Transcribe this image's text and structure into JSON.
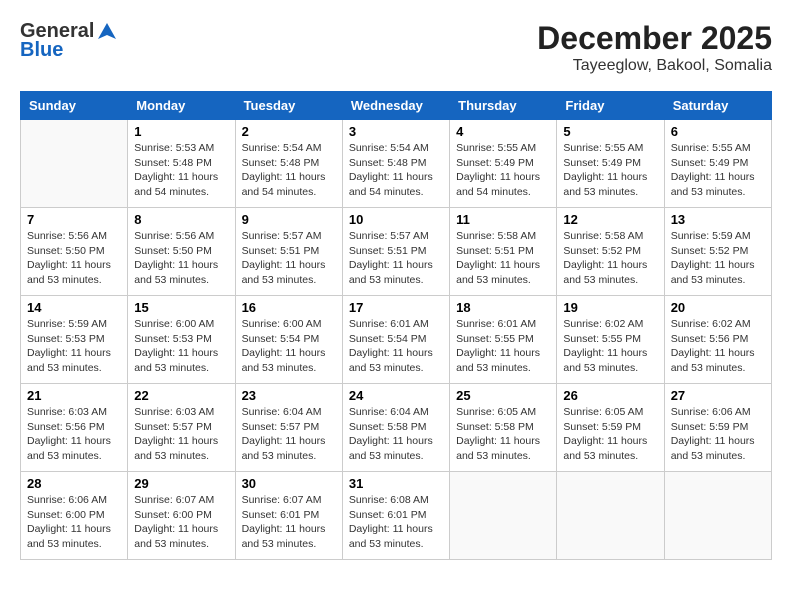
{
  "header": {
    "logo_general": "General",
    "logo_blue": "Blue",
    "month_title": "December 2025",
    "location": "Tayeeglow, Bakool, Somalia"
  },
  "columns": [
    "Sunday",
    "Monday",
    "Tuesday",
    "Wednesday",
    "Thursday",
    "Friday",
    "Saturday"
  ],
  "weeks": [
    [
      {
        "day": "",
        "info": ""
      },
      {
        "day": "1",
        "info": "Sunrise: 5:53 AM\nSunset: 5:48 PM\nDaylight: 11 hours\nand 54 minutes."
      },
      {
        "day": "2",
        "info": "Sunrise: 5:54 AM\nSunset: 5:48 PM\nDaylight: 11 hours\nand 54 minutes."
      },
      {
        "day": "3",
        "info": "Sunrise: 5:54 AM\nSunset: 5:48 PM\nDaylight: 11 hours\nand 54 minutes."
      },
      {
        "day": "4",
        "info": "Sunrise: 5:55 AM\nSunset: 5:49 PM\nDaylight: 11 hours\nand 54 minutes."
      },
      {
        "day": "5",
        "info": "Sunrise: 5:55 AM\nSunset: 5:49 PM\nDaylight: 11 hours\nand 53 minutes."
      },
      {
        "day": "6",
        "info": "Sunrise: 5:55 AM\nSunset: 5:49 PM\nDaylight: 11 hours\nand 53 minutes."
      }
    ],
    [
      {
        "day": "7",
        "info": "Sunrise: 5:56 AM\nSunset: 5:50 PM\nDaylight: 11 hours\nand 53 minutes."
      },
      {
        "day": "8",
        "info": "Sunrise: 5:56 AM\nSunset: 5:50 PM\nDaylight: 11 hours\nand 53 minutes."
      },
      {
        "day": "9",
        "info": "Sunrise: 5:57 AM\nSunset: 5:51 PM\nDaylight: 11 hours\nand 53 minutes."
      },
      {
        "day": "10",
        "info": "Sunrise: 5:57 AM\nSunset: 5:51 PM\nDaylight: 11 hours\nand 53 minutes."
      },
      {
        "day": "11",
        "info": "Sunrise: 5:58 AM\nSunset: 5:51 PM\nDaylight: 11 hours\nand 53 minutes."
      },
      {
        "day": "12",
        "info": "Sunrise: 5:58 AM\nSunset: 5:52 PM\nDaylight: 11 hours\nand 53 minutes."
      },
      {
        "day": "13",
        "info": "Sunrise: 5:59 AM\nSunset: 5:52 PM\nDaylight: 11 hours\nand 53 minutes."
      }
    ],
    [
      {
        "day": "14",
        "info": "Sunrise: 5:59 AM\nSunset: 5:53 PM\nDaylight: 11 hours\nand 53 minutes."
      },
      {
        "day": "15",
        "info": "Sunrise: 6:00 AM\nSunset: 5:53 PM\nDaylight: 11 hours\nand 53 minutes."
      },
      {
        "day": "16",
        "info": "Sunrise: 6:00 AM\nSunset: 5:54 PM\nDaylight: 11 hours\nand 53 minutes."
      },
      {
        "day": "17",
        "info": "Sunrise: 6:01 AM\nSunset: 5:54 PM\nDaylight: 11 hours\nand 53 minutes."
      },
      {
        "day": "18",
        "info": "Sunrise: 6:01 AM\nSunset: 5:55 PM\nDaylight: 11 hours\nand 53 minutes."
      },
      {
        "day": "19",
        "info": "Sunrise: 6:02 AM\nSunset: 5:55 PM\nDaylight: 11 hours\nand 53 minutes."
      },
      {
        "day": "20",
        "info": "Sunrise: 6:02 AM\nSunset: 5:56 PM\nDaylight: 11 hours\nand 53 minutes."
      }
    ],
    [
      {
        "day": "21",
        "info": "Sunrise: 6:03 AM\nSunset: 5:56 PM\nDaylight: 11 hours\nand 53 minutes."
      },
      {
        "day": "22",
        "info": "Sunrise: 6:03 AM\nSunset: 5:57 PM\nDaylight: 11 hours\nand 53 minutes."
      },
      {
        "day": "23",
        "info": "Sunrise: 6:04 AM\nSunset: 5:57 PM\nDaylight: 11 hours\nand 53 minutes."
      },
      {
        "day": "24",
        "info": "Sunrise: 6:04 AM\nSunset: 5:58 PM\nDaylight: 11 hours\nand 53 minutes."
      },
      {
        "day": "25",
        "info": "Sunrise: 6:05 AM\nSunset: 5:58 PM\nDaylight: 11 hours\nand 53 minutes."
      },
      {
        "day": "26",
        "info": "Sunrise: 6:05 AM\nSunset: 5:59 PM\nDaylight: 11 hours\nand 53 minutes."
      },
      {
        "day": "27",
        "info": "Sunrise: 6:06 AM\nSunset: 5:59 PM\nDaylight: 11 hours\nand 53 minutes."
      }
    ],
    [
      {
        "day": "28",
        "info": "Sunrise: 6:06 AM\nSunset: 6:00 PM\nDaylight: 11 hours\nand 53 minutes."
      },
      {
        "day": "29",
        "info": "Sunrise: 6:07 AM\nSunset: 6:00 PM\nDaylight: 11 hours\nand 53 minutes."
      },
      {
        "day": "30",
        "info": "Sunrise: 6:07 AM\nSunset: 6:01 PM\nDaylight: 11 hours\nand 53 minutes."
      },
      {
        "day": "31",
        "info": "Sunrise: 6:08 AM\nSunset: 6:01 PM\nDaylight: 11 hours\nand 53 minutes."
      },
      {
        "day": "",
        "info": ""
      },
      {
        "day": "",
        "info": ""
      },
      {
        "day": "",
        "info": ""
      }
    ]
  ]
}
